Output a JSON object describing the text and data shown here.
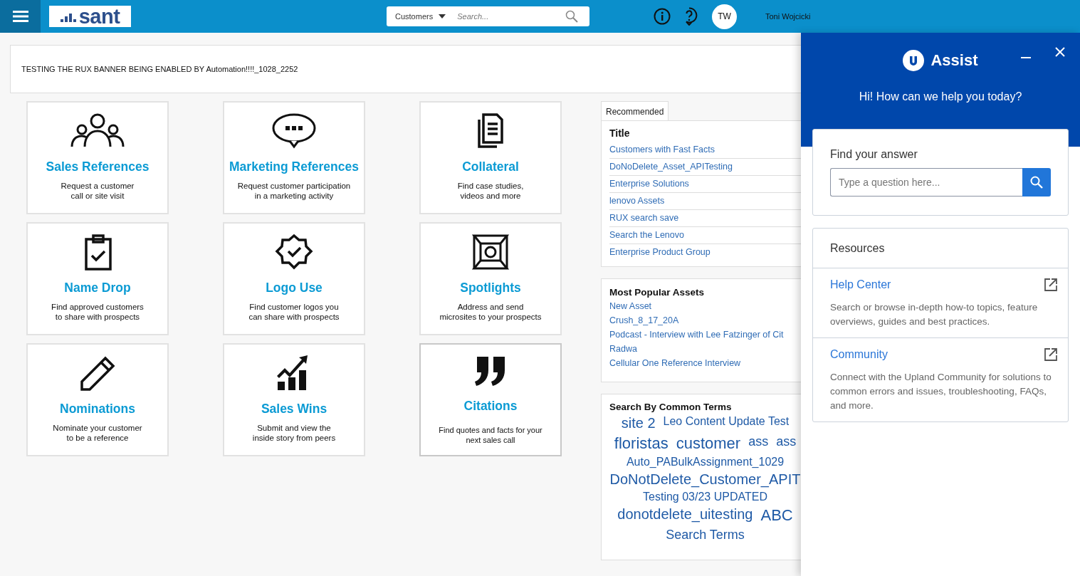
{
  "header": {
    "logo": "sant",
    "search": {
      "scope": "Customers",
      "placeholder": "Search..."
    },
    "avatar": "TW",
    "user": "Toni Wojcicki"
  },
  "banner": "TESTING THE RUX BANNER BEING ENABLED BY Automation!!!!_1028_2252",
  "tiles": [
    {
      "title": "Sales References",
      "description": [
        "Request a customer",
        "call or site visit"
      ],
      "highlighted": false
    },
    {
      "title": "Marketing References",
      "description": [
        "Request customer participation",
        "in a marketing activity"
      ],
      "highlighted": false
    },
    {
      "title": "Collateral",
      "description": [
        "Find case studies,",
        "videos and more"
      ],
      "highlighted": false
    },
    {
      "title": "Name Drop",
      "description": [
        "Find approved customers",
        "to share with prospects"
      ],
      "highlighted": false
    },
    {
      "title": "Logo Use",
      "description": [
        "Find customer logos you",
        "can share with prospects"
      ],
      "highlighted": false
    },
    {
      "title": "Spotlights",
      "description": [
        "Address and send",
        "microsites to your prospects"
      ],
      "highlighted": false
    },
    {
      "title": "Nominations",
      "description": [
        "Nominate your customer",
        "to be a reference"
      ],
      "highlighted": false
    },
    {
      "title": "Sales Wins",
      "description": [
        "Submit and view the",
        "inside story from peers"
      ],
      "highlighted": false
    },
    {
      "title": "Citations",
      "description": [
        "Find quotes and facts for your",
        "next sales call"
      ],
      "highlighted": true
    }
  ],
  "recommended": {
    "tabs": [
      {
        "label": "Recommended",
        "selected": true
      }
    ],
    "column": "Title",
    "rows": [
      "Customers with Fast Facts",
      "DoNoDelete_Asset_APITesting",
      "Enterprise Solutions",
      "lenovo Assets",
      "RUX search save",
      "Search the Lenovo",
      "Enterprise Product Group"
    ]
  },
  "popular": {
    "title": "Most Popular Assets",
    "items": [
      "New Asset",
      "Crush_8_17_20A",
      "Podcast - Interview with Lee Fatzinger of Cit",
      "Radwa",
      "Cellular One Reference Interview"
    ]
  },
  "terms": {
    "title": "Search By Common Terms",
    "rows": [
      [
        {
          "text": "site 2",
          "kind": "large"
        },
        {
          "text": "Leo Content Update Test",
          "kind": "small"
        }
      ],
      [
        {
          "text": "floristas",
          "kind": "huge"
        },
        {
          "text": "customer",
          "kind": "huge"
        },
        {
          "text": "ass",
          "kind": "medium"
        },
        {
          "text": "ass",
          "kind": "medium"
        }
      ],
      [
        {
          "text": "Auto_PABulkAssignment_1029",
          "kind": "small"
        }
      ],
      [
        {
          "text": "DoNotDelete_Customer_APIT",
          "kind": "large"
        }
      ],
      [
        {
          "text": "Testing 03/23 UPDATED",
          "kind": "small"
        }
      ],
      [
        {
          "text": "donotdelete_uitesting",
          "kind": "large"
        },
        {
          "text": "ABC",
          "kind": "huge"
        }
      ],
      [
        {
          "text": "Search Terms",
          "kind": "medium"
        }
      ]
    ]
  },
  "assist": {
    "title": "Assist",
    "greeting": "Hi! How can we help you today?",
    "find_title": "Find your answer",
    "placeholder": "Type a question here...",
    "resources_title": "Resources",
    "resources": [
      {
        "title": "Help Center",
        "description": "Search or browse in-depth how-to topics, feature overviews, guides and best practices."
      },
      {
        "title": "Community",
        "description": "Connect with the Upland Community for solutions to common errors and issues, troubleshooting, FAQs, and more."
      }
    ]
  }
}
